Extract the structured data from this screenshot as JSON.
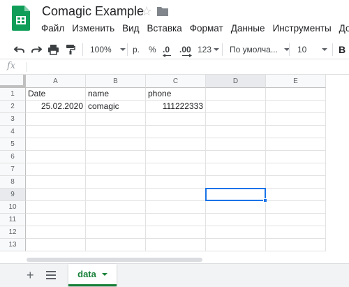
{
  "app": {
    "logo_icon": "google-sheets-icon",
    "brand_color": "#0f9d58"
  },
  "document": {
    "title": "Comagic Example"
  },
  "menu": [
    {
      "label": "Файл"
    },
    {
      "label": "Изменить"
    },
    {
      "label": "Вид"
    },
    {
      "label": "Вставка"
    },
    {
      "label": "Формат"
    },
    {
      "label": "Данные"
    },
    {
      "label": "Инструменты"
    },
    {
      "label": "Допол"
    }
  ],
  "toolbar": {
    "zoom": "100%",
    "currency": "р.",
    "percent": "%",
    "decrease_decimals": ".0",
    "increase_decimals": ".00",
    "more_formats": "123",
    "font_family": "По умолча...",
    "font_size": "10",
    "bold": "B",
    "icons": [
      "undo-icon",
      "redo-icon",
      "print-icon",
      "paint-format-icon"
    ]
  },
  "formula_bar": {
    "label": "fx",
    "value": ""
  },
  "grid": {
    "columns": [
      "A",
      "B",
      "C",
      "D",
      "E"
    ],
    "rows": [
      "1",
      "2",
      "3",
      "4",
      "5",
      "6",
      "7",
      "8",
      "9",
      "10",
      "11",
      "12",
      "13"
    ],
    "cells": {
      "A1": "Date",
      "B1": "name",
      "C1": "phone",
      "A2": "25.02.2020",
      "B2": "comagic",
      "C2": "111222333"
    },
    "selected_cell": "D9",
    "selection_color": "#1a73e8"
  },
  "sheets": [
    {
      "name": "data",
      "active": true,
      "color": "#188038"
    }
  ]
}
